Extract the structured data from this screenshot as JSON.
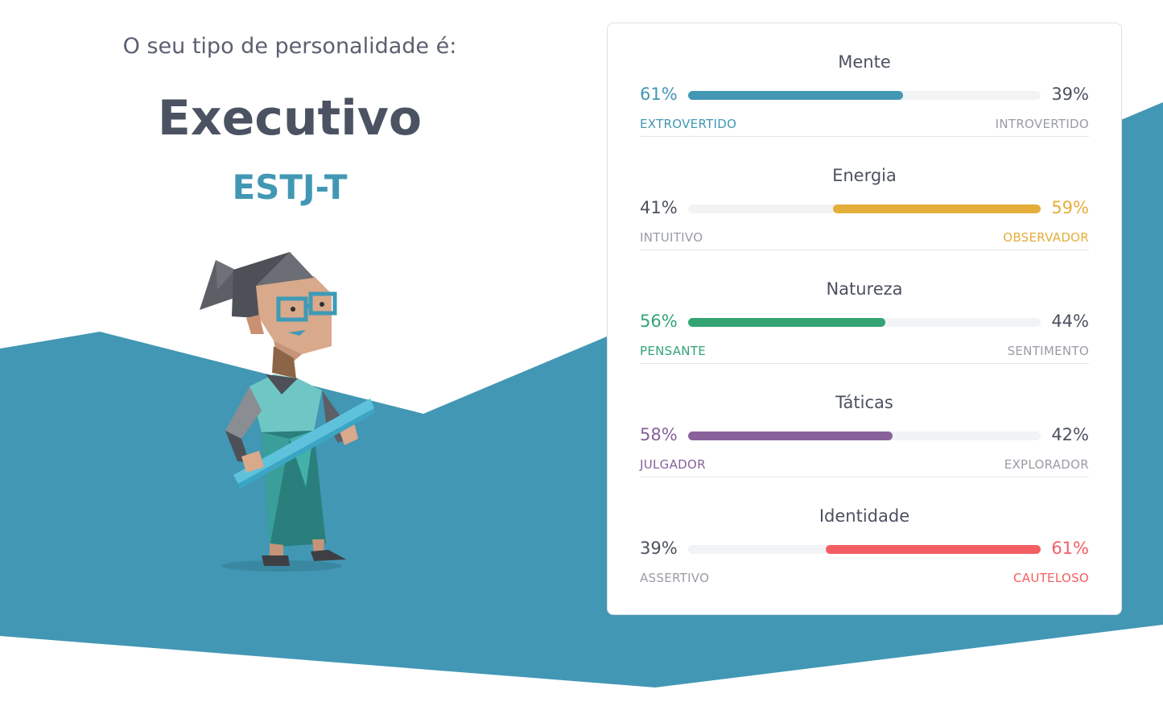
{
  "header": {
    "intro": "O seu tipo de personalidade é:",
    "type_name": "Executivo",
    "type_code": "ESTJ-T"
  },
  "colors": {
    "background_accent": "#4297b4",
    "mind": "#4298b4",
    "energy": "#e4ae3a",
    "nature": "#33a474",
    "tactics": "#88619a",
    "identity": "#f25e62",
    "muted_text": "#999ca4",
    "heading_text": "#4b5262"
  },
  "traits": [
    {
      "title": "Mente",
      "left_pct": "61%",
      "right_pct": "39%",
      "left_label": "EXTROVERTIDO",
      "right_label": "INTROVERTIDO",
      "dominant": "left",
      "value": 0.61,
      "color": "#4298b4"
    },
    {
      "title": "Energia",
      "left_pct": "41%",
      "right_pct": "59%",
      "left_label": "INTUITIVO",
      "right_label": "OBSERVADOR",
      "dominant": "right",
      "value": 0.59,
      "color": "#e4ae3a"
    },
    {
      "title": "Natureza",
      "left_pct": "56%",
      "right_pct": "44%",
      "left_label": "PENSANTE",
      "right_label": "SENTIMENTO",
      "dominant": "left",
      "value": 0.56,
      "color": "#33a474"
    },
    {
      "title": "Táticas",
      "left_pct": "58%",
      "right_pct": "42%",
      "left_label": "JULGADOR",
      "right_label": "EXPLORADOR",
      "dominant": "left",
      "value": 0.58,
      "color": "#88619a"
    },
    {
      "title": "Identidade",
      "left_pct": "39%",
      "right_pct": "61%",
      "left_label": "ASSERTIVO",
      "right_label": "CAUTELOSO",
      "dominant": "right",
      "value": 0.61,
      "color": "#f25e62"
    }
  ],
  "avatar": {
    "icon": "executive-character-illustration"
  }
}
